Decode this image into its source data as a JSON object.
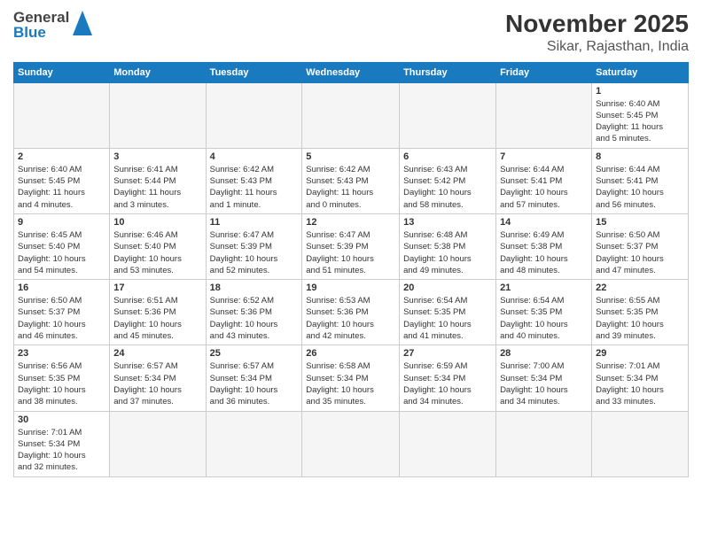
{
  "header": {
    "logo_general": "General",
    "logo_blue": "Blue",
    "title": "November 2025",
    "subtitle": "Sikar, Rajasthan, India"
  },
  "days_of_week": [
    "Sunday",
    "Monday",
    "Tuesday",
    "Wednesday",
    "Thursday",
    "Friday",
    "Saturday"
  ],
  "weeks": [
    [
      {
        "day": "",
        "info": ""
      },
      {
        "day": "",
        "info": ""
      },
      {
        "day": "",
        "info": ""
      },
      {
        "day": "",
        "info": ""
      },
      {
        "day": "",
        "info": ""
      },
      {
        "day": "",
        "info": ""
      },
      {
        "day": "1",
        "info": "Sunrise: 6:40 AM\nSunset: 5:45 PM\nDaylight: 11 hours\nand 5 minutes."
      }
    ],
    [
      {
        "day": "2",
        "info": "Sunrise: 6:40 AM\nSunset: 5:45 PM\nDaylight: 11 hours\nand 4 minutes."
      },
      {
        "day": "3",
        "info": "Sunrise: 6:41 AM\nSunset: 5:44 PM\nDaylight: 11 hours\nand 3 minutes."
      },
      {
        "day": "4",
        "info": "Sunrise: 6:42 AM\nSunset: 5:43 PM\nDaylight: 11 hours\nand 1 minute."
      },
      {
        "day": "5",
        "info": "Sunrise: 6:42 AM\nSunset: 5:43 PM\nDaylight: 11 hours\nand 0 minutes."
      },
      {
        "day": "6",
        "info": "Sunrise: 6:43 AM\nSunset: 5:42 PM\nDaylight: 10 hours\nand 58 minutes."
      },
      {
        "day": "7",
        "info": "Sunrise: 6:44 AM\nSunset: 5:41 PM\nDaylight: 10 hours\nand 57 minutes."
      },
      {
        "day": "8",
        "info": "Sunrise: 6:44 AM\nSunset: 5:41 PM\nDaylight: 10 hours\nand 56 minutes."
      }
    ],
    [
      {
        "day": "9",
        "info": "Sunrise: 6:45 AM\nSunset: 5:40 PM\nDaylight: 10 hours\nand 54 minutes."
      },
      {
        "day": "10",
        "info": "Sunrise: 6:46 AM\nSunset: 5:40 PM\nDaylight: 10 hours\nand 53 minutes."
      },
      {
        "day": "11",
        "info": "Sunrise: 6:47 AM\nSunset: 5:39 PM\nDaylight: 10 hours\nand 52 minutes."
      },
      {
        "day": "12",
        "info": "Sunrise: 6:47 AM\nSunset: 5:39 PM\nDaylight: 10 hours\nand 51 minutes."
      },
      {
        "day": "13",
        "info": "Sunrise: 6:48 AM\nSunset: 5:38 PM\nDaylight: 10 hours\nand 49 minutes."
      },
      {
        "day": "14",
        "info": "Sunrise: 6:49 AM\nSunset: 5:38 PM\nDaylight: 10 hours\nand 48 minutes."
      },
      {
        "day": "15",
        "info": "Sunrise: 6:50 AM\nSunset: 5:37 PM\nDaylight: 10 hours\nand 47 minutes."
      }
    ],
    [
      {
        "day": "16",
        "info": "Sunrise: 6:50 AM\nSunset: 5:37 PM\nDaylight: 10 hours\nand 46 minutes."
      },
      {
        "day": "17",
        "info": "Sunrise: 6:51 AM\nSunset: 5:36 PM\nDaylight: 10 hours\nand 45 minutes."
      },
      {
        "day": "18",
        "info": "Sunrise: 6:52 AM\nSunset: 5:36 PM\nDaylight: 10 hours\nand 43 minutes."
      },
      {
        "day": "19",
        "info": "Sunrise: 6:53 AM\nSunset: 5:36 PM\nDaylight: 10 hours\nand 42 minutes."
      },
      {
        "day": "20",
        "info": "Sunrise: 6:54 AM\nSunset: 5:35 PM\nDaylight: 10 hours\nand 41 minutes."
      },
      {
        "day": "21",
        "info": "Sunrise: 6:54 AM\nSunset: 5:35 PM\nDaylight: 10 hours\nand 40 minutes."
      },
      {
        "day": "22",
        "info": "Sunrise: 6:55 AM\nSunset: 5:35 PM\nDaylight: 10 hours\nand 39 minutes."
      }
    ],
    [
      {
        "day": "23",
        "info": "Sunrise: 6:56 AM\nSunset: 5:35 PM\nDaylight: 10 hours\nand 38 minutes."
      },
      {
        "day": "24",
        "info": "Sunrise: 6:57 AM\nSunset: 5:34 PM\nDaylight: 10 hours\nand 37 minutes."
      },
      {
        "day": "25",
        "info": "Sunrise: 6:57 AM\nSunset: 5:34 PM\nDaylight: 10 hours\nand 36 minutes."
      },
      {
        "day": "26",
        "info": "Sunrise: 6:58 AM\nSunset: 5:34 PM\nDaylight: 10 hours\nand 35 minutes."
      },
      {
        "day": "27",
        "info": "Sunrise: 6:59 AM\nSunset: 5:34 PM\nDaylight: 10 hours\nand 34 minutes."
      },
      {
        "day": "28",
        "info": "Sunrise: 7:00 AM\nSunset: 5:34 PM\nDaylight: 10 hours\nand 34 minutes."
      },
      {
        "day": "29",
        "info": "Sunrise: 7:01 AM\nSunset: 5:34 PM\nDaylight: 10 hours\nand 33 minutes."
      }
    ],
    [
      {
        "day": "30",
        "info": "Sunrise: 7:01 AM\nSunset: 5:34 PM\nDaylight: 10 hours\nand 32 minutes."
      },
      {
        "day": "",
        "info": ""
      },
      {
        "day": "",
        "info": ""
      },
      {
        "day": "",
        "info": ""
      },
      {
        "day": "",
        "info": ""
      },
      {
        "day": "",
        "info": ""
      },
      {
        "day": "",
        "info": ""
      }
    ]
  ]
}
